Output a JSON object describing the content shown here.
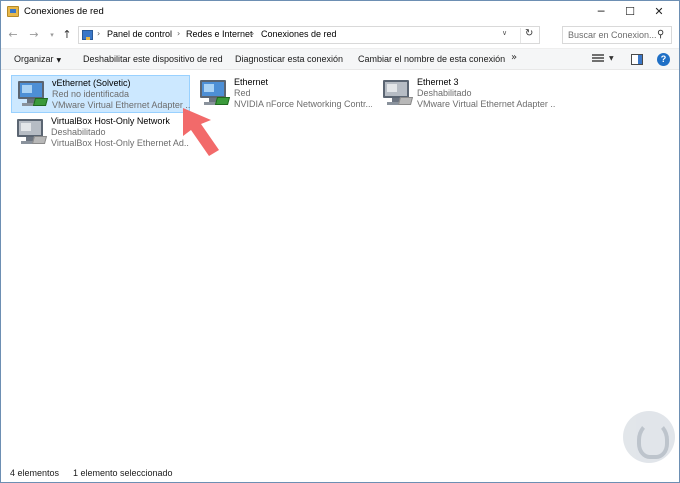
{
  "window": {
    "title": "Conexiones de red",
    "controls": {
      "minimize": "─",
      "maximize": "☐",
      "close": "✕"
    }
  },
  "nav": {
    "back": "←",
    "forward": "→",
    "recent": "▾",
    "up": "↑",
    "breadcrumbs": [
      "Panel de control",
      "Redes e Internet",
      "Conexiones de red"
    ],
    "separator": "›",
    "dropdown": "∨",
    "refresh": "↻",
    "search_placeholder": "Buscar en Conexion...",
    "search_icon": "⚲"
  },
  "commands": {
    "organize": "Organizar",
    "disable_device": "Deshabilitar este dispositivo de red",
    "diagnose": "Diagnosticar esta conexión",
    "rename": "Cambiar el nombre de esta conexión",
    "more": "»",
    "help": "?"
  },
  "connections": [
    {
      "name": "vEthernet (Solvetic)",
      "status": "Red no identificada",
      "adapter": "VMware Virtual Ethernet Adapter ...",
      "selected": true,
      "enabled": true
    },
    {
      "name": "Ethernet",
      "status": "Red",
      "adapter": "NVIDIA nForce Networking Contr...",
      "selected": false,
      "enabled": true
    },
    {
      "name": "Ethernet 3",
      "status": "Deshabilitado",
      "adapter": "VMware Virtual Ethernet Adapter ...",
      "selected": false,
      "enabled": false
    },
    {
      "name": "VirtualBox Host-Only Network",
      "status": "Deshabilitado",
      "adapter": "VirtualBox Host-Only Ethernet Ad...",
      "selected": false,
      "enabled": false
    }
  ],
  "status_bar": {
    "count": "4 elementos",
    "selection": "1 elemento seleccionado"
  },
  "colors": {
    "selection_bg": "#cce8ff",
    "selection_border": "#99d1ff",
    "annotation_arrow": "#f26a6a"
  }
}
